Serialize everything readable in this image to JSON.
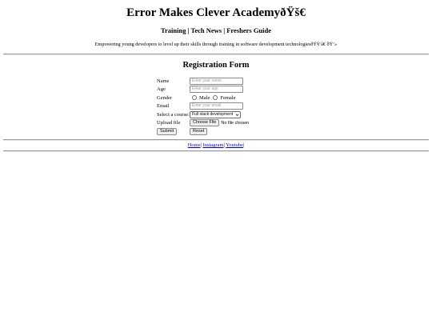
{
  "header": {
    "title": "Error Makes Clever AcademyðŸš€",
    "nav": [
      {
        "label": "Training"
      },
      {
        "label": "Tech News"
      },
      {
        "label": "Freshers Guide"
      }
    ],
    "nav_separator": " | ",
    "tagline": "Empowering young developers to level up their skills through training in software development technologiesðŸ§‘â€ ðŸ’»"
  },
  "form": {
    "title": "Registration Form",
    "name": {
      "label": "Name",
      "placeholder": "Enter your name"
    },
    "age": {
      "label": "Age",
      "placeholder": "Enter your age"
    },
    "gender": {
      "label": "Gender",
      "options": [
        {
          "label": "Male",
          "checked": false
        },
        {
          "label": "Female",
          "checked": false
        }
      ]
    },
    "email": {
      "label": "Email",
      "placeholder": "Enter your email"
    },
    "course": {
      "label": "Select a course:",
      "selected": "Full stack development"
    },
    "upload": {
      "label": "Upload file",
      "button_label": "Choose File",
      "status": "No file chosen"
    },
    "submit_label": "Submit",
    "reset_label": "Reset"
  },
  "footer": {
    "links": [
      {
        "label": "Home"
      },
      {
        "label": "Instagram"
      },
      {
        "label": "Youtube"
      }
    ],
    "separator": "|"
  },
  "colors": {
    "link": "#0000ee",
    "divider": "#9a9a9a",
    "placeholder": "#9b9b9b",
    "button_bg": "#efefef"
  },
  "icons": {
    "course_dropdown": "chevron-down-icon",
    "radio": "radio-circle-icon"
  }
}
